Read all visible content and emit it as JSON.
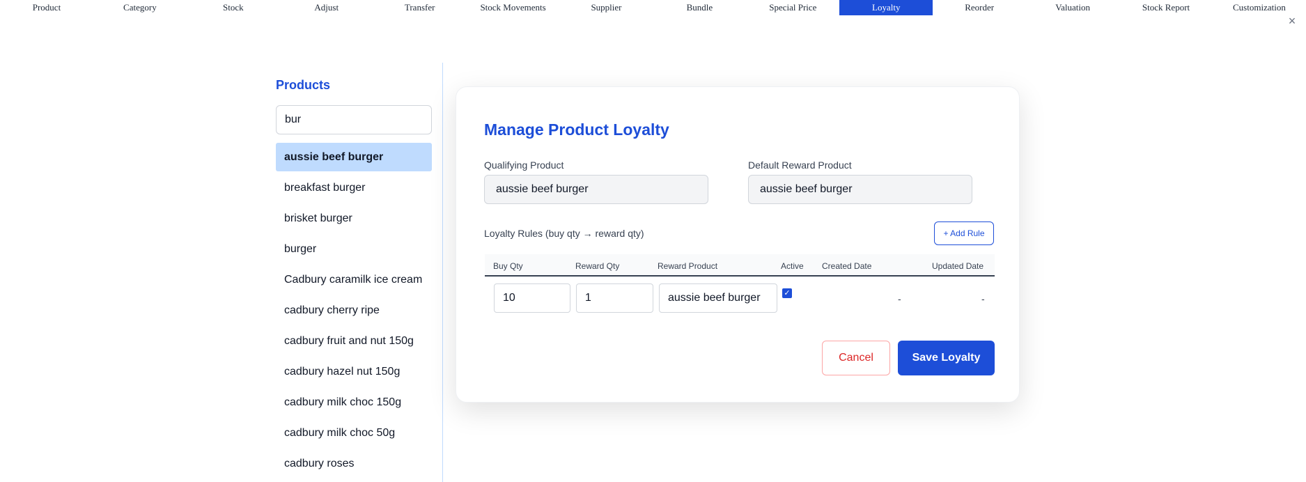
{
  "tabs": [
    {
      "label": "Product",
      "active": false
    },
    {
      "label": "Category",
      "active": false
    },
    {
      "label": "Stock",
      "active": false
    },
    {
      "label": "Adjust",
      "active": false
    },
    {
      "label": "Transfer",
      "active": false
    },
    {
      "label": "Stock Movements",
      "active": false
    },
    {
      "label": "Supplier",
      "active": false
    },
    {
      "label": "Bundle",
      "active": false
    },
    {
      "label": "Special Price",
      "active": false
    },
    {
      "label": "Loyalty",
      "active": true
    },
    {
      "label": "Reorder",
      "active": false
    },
    {
      "label": "Valuation",
      "active": false
    },
    {
      "label": "Stock Report",
      "active": false
    },
    {
      "label": "Customization",
      "active": false
    }
  ],
  "close_icon": "×",
  "products_panel": {
    "title": "Products",
    "search_value": "bur",
    "items": [
      {
        "label": "aussie beef burger",
        "selected": true
      },
      {
        "label": "breakfast burger",
        "selected": false
      },
      {
        "label": "brisket burger",
        "selected": false
      },
      {
        "label": "burger",
        "selected": false
      },
      {
        "label": "Cadbury caramilk ice cream",
        "selected": false
      },
      {
        "label": "cadbury cherry ripe",
        "selected": false
      },
      {
        "label": "cadbury fruit and nut 150g",
        "selected": false
      },
      {
        "label": "cadbury hazel nut 150g",
        "selected": false
      },
      {
        "label": "cadbury milk choc 150g",
        "selected": false
      },
      {
        "label": "cadbury milk choc 50g",
        "selected": false
      },
      {
        "label": "cadbury roses",
        "selected": false
      }
    ]
  },
  "loyalty_form": {
    "title": "Manage Product Loyalty",
    "qualifying_product_label": "Qualifying Product",
    "qualifying_product_value": "aussie beef burger",
    "default_reward_label": "Default Reward Product",
    "default_reward_value": "aussie beef burger",
    "rules_label": "Loyalty Rules (buy qty → reward qty)",
    "add_rule_label": "+ Add Rule",
    "columns": {
      "buy_qty": "Buy Qty",
      "reward_qty": "Reward Qty",
      "reward_product": "Reward Product",
      "active": "Active",
      "created_date": "Created Date",
      "updated_date": "Updated Date"
    },
    "rule": {
      "buy_qty": "10",
      "reward_qty": "1",
      "reward_product": "aussie beef burger",
      "active": true,
      "created_date": "-",
      "updated_date": "-"
    },
    "cancel_label": "Cancel",
    "save_label": "Save Loyalty"
  },
  "colors": {
    "accent": "#1d4ed8",
    "selected_row": "#bfdbfe",
    "cancel": "#dc2626"
  }
}
